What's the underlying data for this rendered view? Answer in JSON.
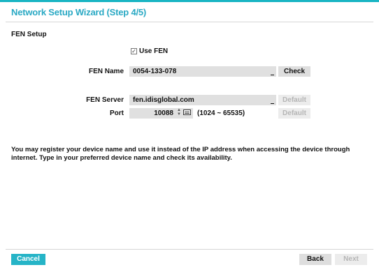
{
  "window": {
    "title": "Network Setup Wizard (Step 4/5)"
  },
  "section": {
    "label": "FEN Setup"
  },
  "use_fen": {
    "label": "Use FEN",
    "checked": true
  },
  "fen_name": {
    "label": "FEN Name",
    "value": "0054-133-078",
    "check_button": "Check"
  },
  "fen_server": {
    "label": "FEN Server",
    "value": "fen.idisglobal.com",
    "default_button": "Default"
  },
  "port": {
    "label": "Port",
    "value": "10088",
    "range": "(1024 ~ 65535)",
    "default_button": "Default"
  },
  "description": "You may register your device name and use it instead of the IP address when accessing the device through internet. Type in your preferred device name and check its availability.",
  "footer": {
    "cancel": "Cancel",
    "back": "Back",
    "next": "Next"
  },
  "colors": {
    "accent": "#26b4c7",
    "title": "#2aa9c4",
    "field": "#e0e0e0"
  },
  "icons": [
    "checkbox-checked-icon",
    "spinner-arrows-icon",
    "keyboard-icon"
  ]
}
